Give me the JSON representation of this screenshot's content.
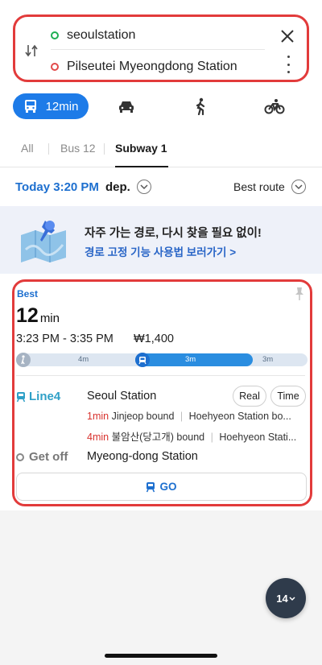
{
  "route": {
    "origin": "seoulstation",
    "destination": "Pilseutei Myeongdong Station"
  },
  "modes": {
    "transit_label": "12min",
    "active": "transit"
  },
  "tabs": {
    "all": "All",
    "bus": "Bus 12",
    "subway": "Subway 1",
    "active": "subway"
  },
  "departure": {
    "time": "Today 3:20 PM",
    "label": "dep.",
    "sort": "Best route"
  },
  "banner": {
    "title": "자주 가는 경로, 다시 찾을 필요 없이!",
    "link": "경로 고정 기능 사용법 보러가기 >"
  },
  "card": {
    "tag": "Best",
    "duration_num": "12",
    "duration_unit": "min",
    "times": "3:23 PM - 3:35 PM",
    "fare": "₩1,400",
    "segments": {
      "walk1": "4m",
      "subway": "3m",
      "walk2": "3m"
    },
    "line": "Line4",
    "board_station": "Seoul Station",
    "real_btn": "Real",
    "time_btn": "Time",
    "arrivals": [
      {
        "mins": "1min",
        "bound": "Jinjeop bound",
        "next": "Hoehyeon Station bo..."
      },
      {
        "mins": "4min",
        "bound": "불암산(당고개) bound",
        "next": "Hoehyeon Stati..."
      }
    ],
    "getoff_label": "Get off",
    "getoff_station": "Myeong-dong Station",
    "go_label": "GO"
  },
  "fab_label": "14",
  "colors": {
    "accent": "#1d7be8",
    "highlight_border": "#e23b3b",
    "line4": "#2fa0c7",
    "arrival": "#d8322e"
  }
}
